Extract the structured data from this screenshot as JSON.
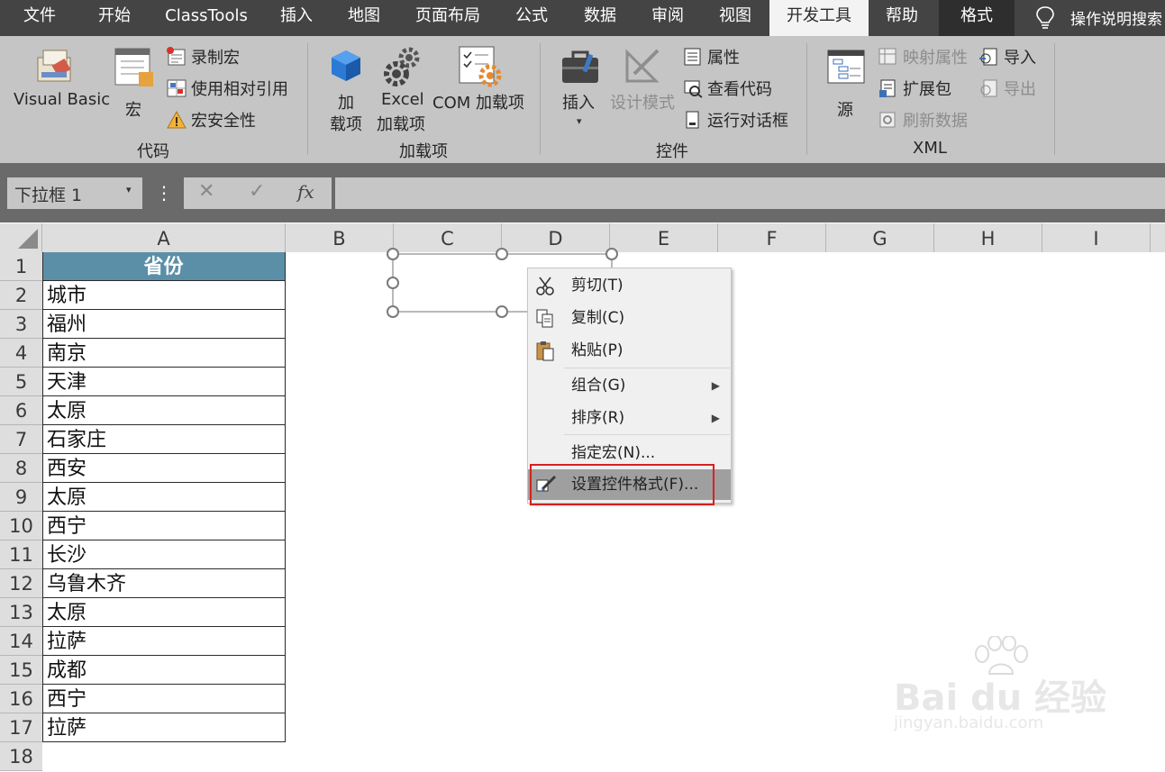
{
  "tabs": [
    "文件",
    "开始",
    "ClassTools",
    "插入",
    "地图",
    "页面布局",
    "公式",
    "数据",
    "审阅",
    "视图",
    "开发工具",
    "帮助",
    "格式"
  ],
  "search_text": "操作说明搜索",
  "ribbon": {
    "code": {
      "visual_basic": "Visual Basic",
      "macro": "宏",
      "record_macro": "录制宏",
      "relative_ref": "使用相对引用",
      "macro_security": "宏安全性",
      "label": "代码"
    },
    "addins": {
      "addin_line1": "加",
      "addin_line2": "载项",
      "excel_line1": "Excel",
      "excel_line2": "加载项",
      "com": "COM 加载项",
      "label": "加载项"
    },
    "controls": {
      "insert": "插入",
      "design_mode": "设计模式",
      "properties": "属性",
      "view_code": "查看代码",
      "run_dialog": "运行对话框",
      "label": "控件"
    },
    "xml": {
      "source": "源",
      "map_props": "映射属性",
      "expansion": "扩展包",
      "refresh": "刷新数据",
      "import": "导入",
      "export": "导出",
      "label": "XML"
    }
  },
  "namebox": "下拉框 1",
  "formula_icons": {
    "cancel": "✕",
    "confirm": "✓",
    "fx": "fx"
  },
  "columns": [
    "A",
    "B",
    "C",
    "D",
    "E",
    "F",
    "G",
    "H",
    "I"
  ],
  "rows": [
    "1",
    "2",
    "3",
    "4",
    "5",
    "6",
    "7",
    "8",
    "9",
    "10",
    "11",
    "12",
    "13",
    "14",
    "15",
    "16",
    "17",
    "18"
  ],
  "cells_A": [
    "省份",
    "城市",
    "福州",
    "南京",
    "天津",
    "太原",
    "石家庄",
    "西安",
    "太原",
    "西宁",
    "长沙",
    "乌鲁木齐",
    "太原",
    "拉萨",
    "成都",
    "西宁",
    "拉萨"
  ],
  "context_menu": {
    "cut": "剪切(T)",
    "copy": "复制(C)",
    "paste": "粘贴(P)",
    "group": "组合(G)",
    "order": "排序(R)",
    "assign_macro": "指定宏(N)...",
    "format_control": "设置控件格式(F)..."
  },
  "watermark": {
    "line1": "Bai du 经验",
    "line2": "jingyan.baidu.com"
  },
  "colors": {
    "accent": "#5b8fa8",
    "highlight": "#d6211f",
    "tabbar": "#444444",
    "ribbon": "#c5c5c5"
  }
}
